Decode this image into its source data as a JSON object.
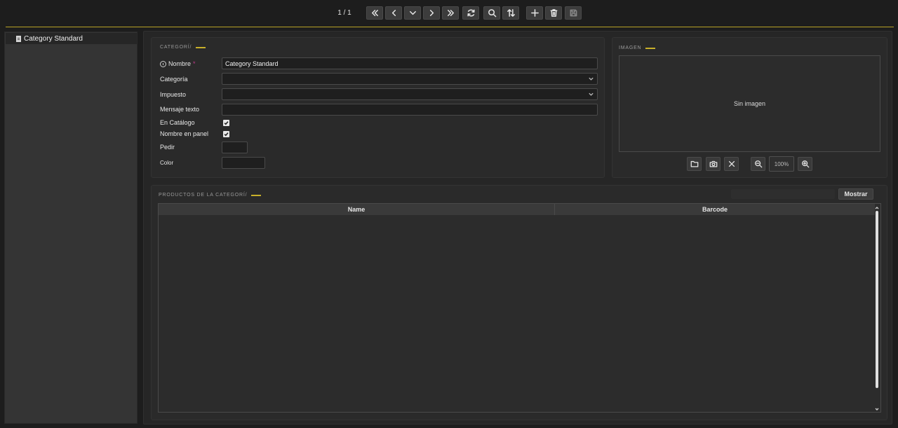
{
  "toolbar": {
    "counter": "1 / 1",
    "buttons": [
      {
        "name": "first-record-button",
        "icon": "double-chevron-left-icon"
      },
      {
        "name": "previous-record-button",
        "icon": "chevron-left-icon"
      },
      {
        "name": "record-list-button",
        "icon": "chevron-down-icon"
      },
      {
        "name": "next-record-button",
        "icon": "chevron-right-icon"
      },
      {
        "name": "last-record-button",
        "icon": "double-chevron-right-icon"
      },
      {
        "name": "reload-button",
        "icon": "refresh-icon"
      },
      {
        "name": "search-button",
        "icon": "search-icon"
      },
      {
        "name": "sort-button",
        "icon": "sort-icon"
      },
      {
        "name": "new-button",
        "icon": "plus-icon"
      },
      {
        "name": "delete-button",
        "icon": "trash-icon"
      },
      {
        "name": "save-button",
        "icon": "save-icon",
        "disabled": true
      }
    ],
    "accent_color": "#b8a226"
  },
  "sidebar": {
    "items": [
      {
        "label": "Category Standard",
        "icon": "document-icon"
      }
    ]
  },
  "category_panel": {
    "legend": "CATEGORÍ/",
    "fields": {
      "name_label": "Nombre",
      "name_required": "*",
      "name_value": "Category Standard",
      "category_label": "Categoría",
      "category_value": "",
      "tax_label": "Impuesto",
      "tax_value": "",
      "text_message_label": "Mensaje texto",
      "text_message_value": "",
      "in_catalog_label": "En Catálogo",
      "in_catalog_checked": true,
      "name_in_panel_label": "Nombre en panel",
      "name_in_panel_checked": true,
      "order_label": "Pedir",
      "color_label": "Color"
    }
  },
  "image_panel": {
    "legend": "IMAGEN",
    "placeholder": "Sin imagen",
    "zoom": "100%",
    "buttons": [
      "folder-icon",
      "camera-icon",
      "close-icon",
      "zoom-out-icon",
      "zoom-in-icon"
    ]
  },
  "products_panel": {
    "legend": "PRODUCTOS DE LA CATEGORÍ/",
    "show_button": "Mostrar",
    "columns": [
      "Name",
      "Barcode"
    ],
    "rows": []
  },
  "colors": {
    "accent": "#c8b02a",
    "required": "#c0398a"
  }
}
